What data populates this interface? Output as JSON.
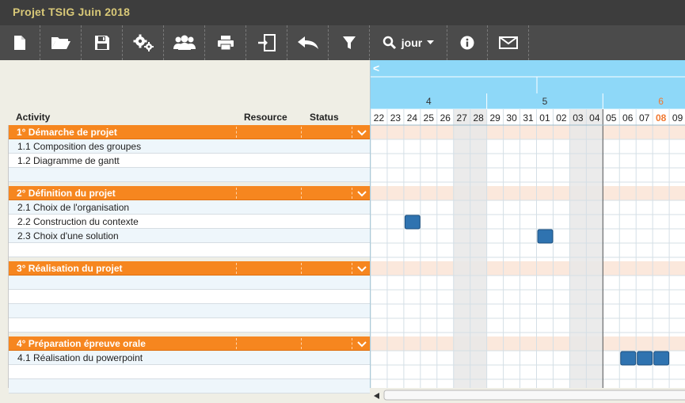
{
  "window": {
    "title": "Projet TSIG Juin 2018"
  },
  "toolbar": {
    "items": [
      {
        "name": "new-file",
        "icon": "file-icon"
      },
      {
        "name": "open-folder",
        "icon": "folder-open-icon"
      },
      {
        "name": "save",
        "icon": "floppy-icon"
      },
      {
        "name": "settings",
        "icon": "gears-icon"
      },
      {
        "name": "users",
        "icon": "users-icon"
      },
      {
        "name": "print",
        "icon": "printer-icon"
      },
      {
        "name": "export",
        "icon": "export-icon"
      },
      {
        "name": "undo",
        "icon": "undo-arrow-icon"
      },
      {
        "name": "filter",
        "icon": "filter-funnel-icon"
      },
      {
        "name": "zoom",
        "icon": "magnifier-icon"
      },
      {
        "name": "info",
        "icon": "info-icon"
      },
      {
        "name": "mail",
        "icon": "envelope-icon"
      }
    ],
    "zoom_label": "jour"
  },
  "grid": {
    "columns": {
      "activity": "Activity",
      "resource": "Resource",
      "status": "Status"
    },
    "groups": [
      {
        "label": "1° Démarche de projet",
        "tasks": [
          "1.1 Composition des groupes",
          "1.2 Diagramme de gantt",
          ""
        ]
      },
      {
        "label": "2° Définition du projet",
        "tasks": [
          "2.1 Choix de l'organisation",
          "2.2 Construction du contexte",
          "2.3 Choix d'une solution",
          ""
        ]
      },
      {
        "label": "3° Réalisation du projet",
        "tasks": [
          "",
          "",
          "",
          ""
        ]
      },
      {
        "label": "4° Préparation épreuve orale",
        "tasks": [
          "4.1 Réalisation du powerpoint",
          "",
          ""
        ]
      }
    ]
  },
  "gantt": {
    "nav_prev": "<",
    "weeks": [
      {
        "label": "4",
        "highlight": false
      },
      {
        "label": "5",
        "highlight": false
      },
      {
        "label": "6",
        "highlight": true
      }
    ],
    "days": [
      "22",
      "23",
      "24",
      "25",
      "26",
      "27",
      "28",
      "29",
      "30",
      "31",
      "01",
      "02",
      "03",
      "04",
      "05",
      "06",
      "07",
      "08",
      "09"
    ],
    "weekend_day_indexes": [
      5,
      6,
      12,
      13
    ],
    "today_day_index": 17,
    "month_boundary_after_index": 13,
    "bars": [
      {
        "group": 1,
        "task": 1,
        "day_index": 2,
        "length_days": 1
      },
      {
        "group": 1,
        "task": 2,
        "day_index": 10,
        "length_days": 1
      },
      {
        "group": 3,
        "task": 0,
        "day_index": 15,
        "length_days": 3
      }
    ],
    "colors": {
      "header_blue": "#8ed8f8",
      "group_row_tint": "#fbe8dc",
      "weekend_tint": "#e7e7e7",
      "bar_fill": "#2f73b0",
      "today_text": "#f07830",
      "group_orange": "#f6861f"
    }
  }
}
